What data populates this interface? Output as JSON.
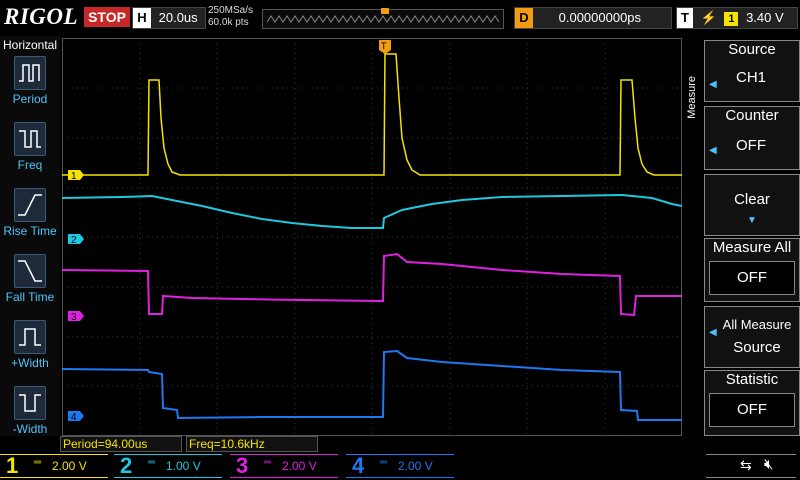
{
  "brand": "RIGOL",
  "status": "STOP",
  "horizontal": {
    "h_label": "H",
    "timebase": "20.0us",
    "sample_rate": "250MSa/s",
    "mem_depth": "60.0k pts"
  },
  "delay": {
    "label": "D",
    "value": "0.00000000ps"
  },
  "trigger": {
    "label": "T",
    "channel": "1",
    "level": "3.40 V"
  },
  "left_menu": {
    "title": "Horizontal",
    "items": [
      {
        "label": "Period",
        "icon": "period-icon"
      },
      {
        "label": "Freq",
        "icon": "frequency-icon"
      },
      {
        "label": "Rise Time",
        "icon": "rise-time-icon"
      },
      {
        "label": "Fall Time",
        "icon": "fall-time-icon"
      },
      {
        "label": "+Width",
        "icon": "positive-width-icon"
      },
      {
        "label": "-Width",
        "icon": "negative-width-icon"
      }
    ]
  },
  "right_menu": {
    "title": "Measure",
    "source": {
      "head": "Source",
      "value": "CH1"
    },
    "counter": {
      "head": "Counter",
      "value": "OFF"
    },
    "clear": {
      "head": "Clear"
    },
    "measure_all": {
      "head": "Measure All",
      "value": "OFF"
    },
    "all_measure_source": {
      "line1": "All Measure",
      "line2": "Source"
    },
    "statistic": {
      "head": "Statistic",
      "value": "OFF"
    }
  },
  "measurements": {
    "period": "Period=94.00us",
    "freq": "Freq=10.6kHz"
  },
  "channels": [
    {
      "num": "1",
      "scale": "2.00 V",
      "color": "#f5e400"
    },
    {
      "num": "2",
      "scale": "1.00 V",
      "color": "#1ec8e0"
    },
    {
      "num": "3",
      "scale": "2.00 V",
      "color": "#e020e0"
    },
    {
      "num": "4",
      "scale": "2.00 V",
      "color": "#1e78f0"
    }
  ],
  "markers": {
    "ch1": "1",
    "ch2": "2",
    "ch3": "3",
    "ch4": "4",
    "trigger": "T"
  }
}
